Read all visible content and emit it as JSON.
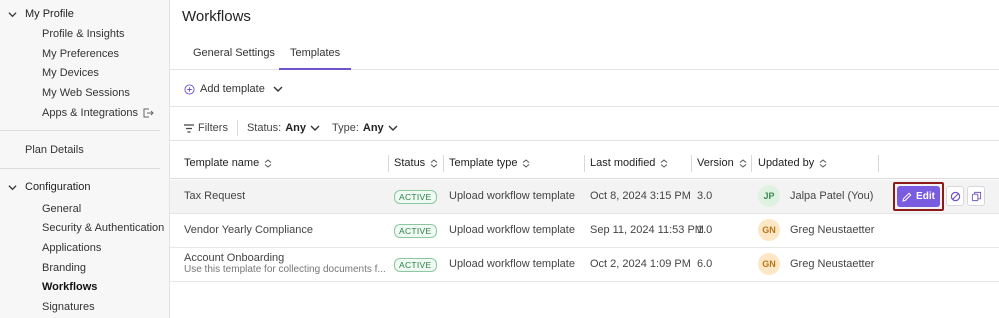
{
  "sidebar": {
    "my_profile": {
      "label": "My Profile",
      "items": [
        "Profile & Insights",
        "My Preferences",
        "My Devices",
        "My Web Sessions",
        "Apps & Integrations"
      ]
    },
    "plan_details": "Plan Details",
    "configuration": {
      "label": "Configuration",
      "items": [
        "General",
        "Security & Authentication",
        "Applications",
        "Branding",
        "Workflows",
        "Signatures"
      ],
      "active": "Workflows"
    }
  },
  "main": {
    "title": "Workflows",
    "tabs": [
      "General Settings",
      "Templates"
    ],
    "active_tab": "Templates",
    "add_template": "Add template",
    "filters": {
      "label": "Filters",
      "status_label": "Status:",
      "status_value": "Any",
      "type_label": "Type:",
      "type_value": "Any"
    },
    "table": {
      "columns": [
        "Template name",
        "Status",
        "Template type",
        "Last modified",
        "Version",
        "Updated by"
      ],
      "rows": [
        {
          "name": "Tax Request",
          "description": "",
          "status": "ACTIVE",
          "type": "Upload workflow template",
          "modified": "Oct 8, 2024 3:15 PM",
          "version": "3.0",
          "initials": "JP",
          "user": "Jalpa Patel (You)"
        },
        {
          "name": "Vendor Yearly Compliance",
          "description": "",
          "status": "ACTIVE",
          "type": "Upload workflow template",
          "modified": "Sep 11, 2024 11:53 PM",
          "version": "1.0",
          "initials": "GN",
          "user": "Greg Neustaetter"
        },
        {
          "name": "Account Onboarding",
          "description": "Use this template for collecting documents f...",
          "status": "ACTIVE",
          "type": "Upload workflow template",
          "modified": "Oct 2, 2024 1:09 PM",
          "version": "6.0",
          "initials": "GN",
          "user": "Greg Neustaetter"
        }
      ]
    },
    "actions": {
      "edit_label": "Edit"
    }
  },
  "colors": {
    "accent": "#7a5ce0",
    "tab_underline": "#6e54c8",
    "active_badge": "#2e7d4a",
    "highlight_border": "#8b1a1a",
    "avatar_green": "#dff2e1",
    "avatar_orange": "#fde7c4"
  },
  "icons": [
    "chevron-down-icon",
    "external-link-icon",
    "plus-circle-icon",
    "filter-icon",
    "sort-icon",
    "pencil-icon",
    "block-icon",
    "copy-icon"
  ]
}
